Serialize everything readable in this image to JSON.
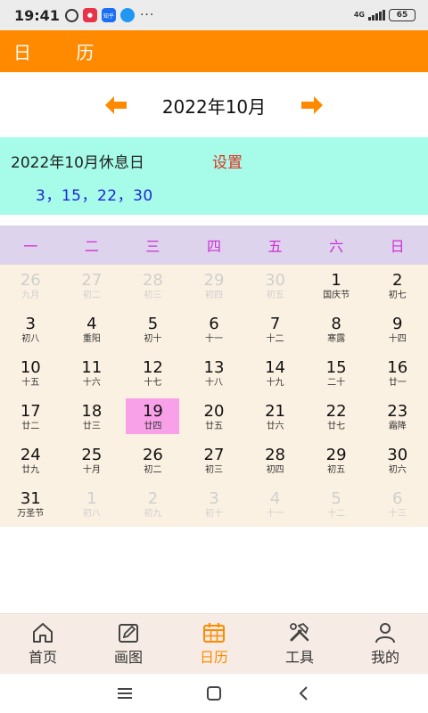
{
  "status_bar": {
    "time": "19:41",
    "icons": [
      "alarm-icon",
      "app-notification-icon",
      "zhihu-icon",
      "message-bubble-icon"
    ],
    "zhihu_label": "知乎",
    "more": "···",
    "network": "4G",
    "battery": "65"
  },
  "header": {
    "title": "日 历"
  },
  "month_nav": {
    "current": "2022年10月"
  },
  "holiday": {
    "title": "2022年10月休息日",
    "setting_label": "设置",
    "days": "3，15，22，30"
  },
  "weekdays": [
    "一",
    "二",
    "三",
    "四",
    "五",
    "六",
    "日"
  ],
  "calendar": {
    "selected_day": "19",
    "cells": [
      {
        "day": "26",
        "lunar": "九月",
        "muted": true
      },
      {
        "day": "27",
        "lunar": "初二",
        "muted": true
      },
      {
        "day": "28",
        "lunar": "初三",
        "muted": true
      },
      {
        "day": "29",
        "lunar": "初四",
        "muted": true
      },
      {
        "day": "30",
        "lunar": "初五",
        "muted": true
      },
      {
        "day": "1",
        "lunar": "国庆节",
        "muted": false
      },
      {
        "day": "2",
        "lunar": "初七",
        "muted": false
      },
      {
        "day": "3",
        "lunar": "初八",
        "muted": false
      },
      {
        "day": "4",
        "lunar": "重阳",
        "muted": false
      },
      {
        "day": "5",
        "lunar": "初十",
        "muted": false
      },
      {
        "day": "6",
        "lunar": "十一",
        "muted": false
      },
      {
        "day": "7",
        "lunar": "十二",
        "muted": false
      },
      {
        "day": "8",
        "lunar": "寒露",
        "muted": false
      },
      {
        "day": "9",
        "lunar": "十四",
        "muted": false
      },
      {
        "day": "10",
        "lunar": "十五",
        "muted": false
      },
      {
        "day": "11",
        "lunar": "十六",
        "muted": false
      },
      {
        "day": "12",
        "lunar": "十七",
        "muted": false
      },
      {
        "day": "13",
        "lunar": "十八",
        "muted": false
      },
      {
        "day": "14",
        "lunar": "十九",
        "muted": false
      },
      {
        "day": "15",
        "lunar": "二十",
        "muted": false
      },
      {
        "day": "16",
        "lunar": "廿一",
        "muted": false
      },
      {
        "day": "17",
        "lunar": "廿二",
        "muted": false
      },
      {
        "day": "18",
        "lunar": "廿三",
        "muted": false
      },
      {
        "day": "19",
        "lunar": "廿四",
        "muted": false
      },
      {
        "day": "20",
        "lunar": "廿五",
        "muted": false
      },
      {
        "day": "21",
        "lunar": "廿六",
        "muted": false
      },
      {
        "day": "22",
        "lunar": "廿七",
        "muted": false
      },
      {
        "day": "23",
        "lunar": "霜降",
        "muted": false
      },
      {
        "day": "24",
        "lunar": "廿九",
        "muted": false
      },
      {
        "day": "25",
        "lunar": "十月",
        "muted": false
      },
      {
        "day": "26",
        "lunar": "初二",
        "muted": false
      },
      {
        "day": "27",
        "lunar": "初三",
        "muted": false
      },
      {
        "day": "28",
        "lunar": "初四",
        "muted": false
      },
      {
        "day": "29",
        "lunar": "初五",
        "muted": false
      },
      {
        "day": "30",
        "lunar": "初六",
        "muted": false
      },
      {
        "day": "31",
        "lunar": "万圣节",
        "muted": false
      },
      {
        "day": "1",
        "lunar": "初八",
        "muted": true
      },
      {
        "day": "2",
        "lunar": "初九",
        "muted": true
      },
      {
        "day": "3",
        "lunar": "初十",
        "muted": true
      },
      {
        "day": "4",
        "lunar": "十一",
        "muted": true
      },
      {
        "day": "5",
        "lunar": "十二",
        "muted": true
      },
      {
        "day": "6",
        "lunar": "十三",
        "muted": true
      }
    ]
  },
  "bottom_nav": {
    "items": [
      {
        "label": "首页",
        "icon": "home-icon",
        "active": false
      },
      {
        "label": "画图",
        "icon": "edit-icon",
        "active": false
      },
      {
        "label": "日历",
        "icon": "calendar-icon",
        "active": true
      },
      {
        "label": "工具",
        "icon": "tools-icon",
        "active": false
      },
      {
        "label": "我的",
        "icon": "user-icon",
        "active": false
      }
    ]
  },
  "colors": {
    "accent": "#ff8a00",
    "holiday_bg": "#a6fbe9",
    "weekday_bg": "#ddd3ec",
    "weekday_text": "#cf2fd6",
    "calendar_bg": "#fbf1e2",
    "today_bg": "#f8a0e8",
    "setting_text": "#e0301e",
    "holiday_days_text": "#1f27d6"
  }
}
